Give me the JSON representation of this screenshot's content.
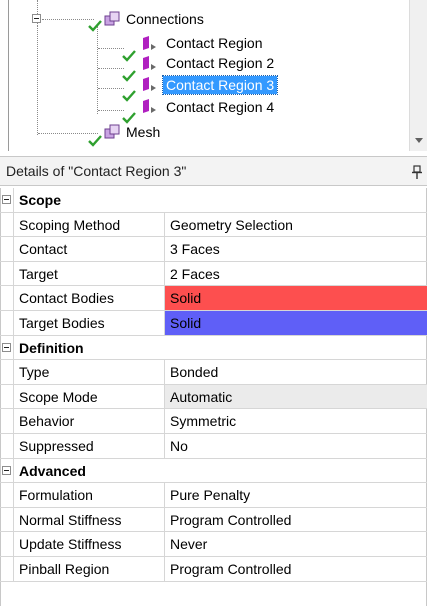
{
  "tree": {
    "nodes": [
      {
        "label": "Connections",
        "icon": "connections-folder-icon",
        "state": "expanded"
      },
      {
        "label": "Contact Region",
        "icon": "contact-region-icon",
        "status": "ok"
      },
      {
        "label": "Contact Region 2",
        "icon": "contact-region-icon",
        "status": "ok"
      },
      {
        "label": "Contact Region 3",
        "icon": "contact-region-icon",
        "status": "ok",
        "selected": true
      },
      {
        "label": "Contact Region 4",
        "icon": "contact-region-icon",
        "status": "ok"
      },
      {
        "label": "Mesh",
        "icon": "mesh-icon",
        "status": "ok"
      }
    ]
  },
  "details": {
    "title": "Details of \"Contact Region 3\"",
    "pin_icon": "pin-icon",
    "groups": [
      {
        "name": "Scope",
        "rows": [
          {
            "name": "Scoping Method",
            "value": "Geometry Selection"
          },
          {
            "name": "Contact",
            "value": "3 Faces"
          },
          {
            "name": "Target",
            "value": "2 Faces"
          },
          {
            "name": "Contact Bodies",
            "value": "Solid",
            "color": "#fd4f4f"
          },
          {
            "name": "Target Bodies",
            "value": "Solid",
            "color": "#5f5ff7"
          }
        ]
      },
      {
        "name": "Definition",
        "rows": [
          {
            "name": "Type",
            "value": "Bonded"
          },
          {
            "name": "Scope Mode",
            "value": "Automatic",
            "color": "#ebebeb"
          },
          {
            "name": "Behavior",
            "value": "Symmetric"
          },
          {
            "name": "Suppressed",
            "value": "No"
          }
        ]
      },
      {
        "name": "Advanced",
        "rows": [
          {
            "name": "Formulation",
            "value": "Pure Penalty"
          },
          {
            "name": "Normal Stiffness",
            "value": "Program Controlled"
          },
          {
            "name": "Update Stiffness",
            "value": "Never"
          },
          {
            "name": "Pinball Region",
            "value": "Program Controlled"
          }
        ]
      }
    ]
  },
  "colors": {
    "selection": "#3399ff",
    "check": "#2fa02f",
    "contact_icon": "#b020c0"
  }
}
